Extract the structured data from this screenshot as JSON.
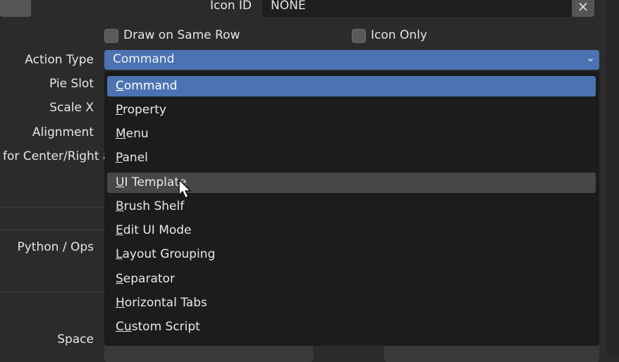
{
  "header": {
    "icon_id_label": "Icon ID",
    "icon_id_value": "NONE",
    "clear_icon": "x-icon"
  },
  "options": {
    "draw_same_row": "Draw on Same Row",
    "icon_only": "Icon Only"
  },
  "labels": {
    "action_type": "Action Type",
    "pie_slot": "Pie Slot",
    "scale_x": "Scale X",
    "alignment": "Alignment",
    "center_right": "for Center/Right a",
    "python_ops": "Python / Ops",
    "space": "Space"
  },
  "dropdown": {
    "selected": "Command",
    "chevron_icon": "chevron-down-icon",
    "items": [
      {
        "first": "C",
        "rest": "ommand"
      },
      {
        "first": "P",
        "rest": "roperty"
      },
      {
        "first": "M",
        "rest": "enu"
      },
      {
        "first": "P",
        "rest": "anel"
      },
      {
        "first": "U",
        "rest": "I Template"
      },
      {
        "first": "B",
        "rest": "rush Shelf"
      },
      {
        "first": "E",
        "rest": "dit UI Mode"
      },
      {
        "first": "L",
        "rest": "ayout Grouping"
      },
      {
        "first": "S",
        "rest": "eparator"
      },
      {
        "first": "H",
        "rest": "orizontal Tabs"
      },
      {
        "first": "Cu",
        "rest": "stom Script"
      }
    ]
  },
  "colors": {
    "accent": "#4c72b3",
    "background": "#2b2b2b",
    "menu_bg": "#1c1c1c",
    "hover": "#474747"
  }
}
